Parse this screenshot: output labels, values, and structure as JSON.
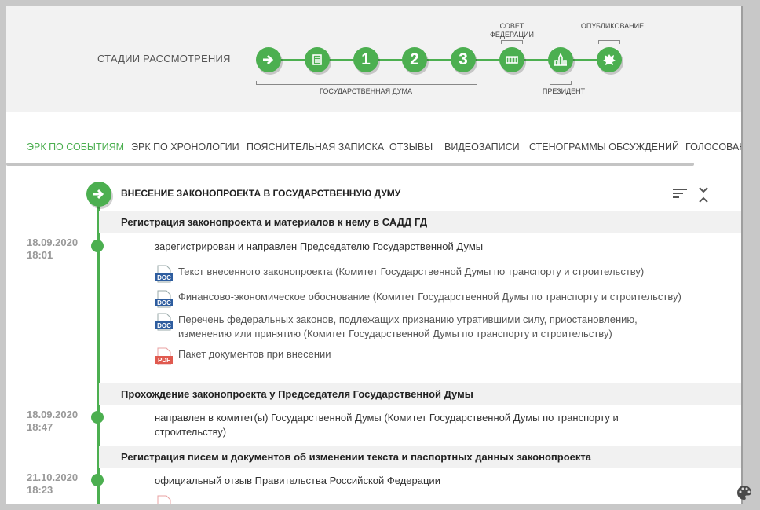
{
  "stages": {
    "title": "СТАДИИ РАССМОТРЕНИЯ",
    "steps": [
      {
        "icon": "arrow-right-icon",
        "label": ""
      },
      {
        "icon": "document-stack-icon",
        "label": ""
      },
      {
        "icon": "number-icon",
        "label": "1"
      },
      {
        "icon": "number-icon",
        "label": "2"
      },
      {
        "icon": "number-icon",
        "label": "3"
      },
      {
        "icon": "federation-council-icon",
        "label": ""
      },
      {
        "icon": "kremlin-icon",
        "label": ""
      },
      {
        "icon": "coat-of-arms-icon",
        "label": ""
      }
    ],
    "caption_duma": "ГОСУДАРСТВЕННАЯ ДУМА",
    "caption_council": "СОВЕТ ФЕДЕРАЦИИ",
    "caption_president": "ПРЕЗИДЕНТ",
    "caption_publication": "ОПУБЛИКОВАНИЕ"
  },
  "tabs": [
    {
      "label": "ЭРК ПО СОБЫТИЯМ",
      "active": true
    },
    {
      "label": "ЭРК ПО ХРОНОЛОГИИ"
    },
    {
      "label": "ПОЯСНИТЕЛЬНАЯ ЗАПИСКА"
    },
    {
      "label": "ОТЗЫВЫ"
    },
    {
      "label": "ВИДЕОЗАПИСИ"
    },
    {
      "label": "СТЕНОГРАММЫ ОБСУЖДЕНИЙ"
    },
    {
      "label": "ГОЛОСОВАН"
    }
  ],
  "section": {
    "title": "ВНЕСЕНИЕ ЗАКОНОПРОЕКТА В ГОСУДАРСТВЕННУЮ ДУМУ"
  },
  "groups": [
    {
      "title": "Регистрация законопроекта и материалов к нему в САДД ГД",
      "date": "18.09.2020",
      "time": "18:01",
      "event": "зарегистрирован и направлен Председателю Государственной Думы",
      "docs": [
        {
          "type": "DOC",
          "text": "Текст внесенного законопроекта (Комитет Государственной Думы по транспорту и строительству)"
        },
        {
          "type": "DOC",
          "text": "Финансово-экономическое обоснование (Комитет Государственной Думы по транспорту и строительству)"
        },
        {
          "type": "DOC",
          "text": "Перечень федеральных законов, подлежащих признанию утратившими силу, приостановлению,",
          "text2": "изменению или принятию (Комитет Государственной Думы по транспорту и строительству)"
        },
        {
          "type": "PDF",
          "text": "Пакет документов при внесении"
        }
      ]
    },
    {
      "title": "Прохождение законопроекта у Председателя Государственной Думы",
      "date": "18.09.2020",
      "time": "18:47",
      "event": "направлен в комитет(ы) Государственной Думы (Комитет Государственной Думы по транспорту и",
      "event2": "строительству)"
    },
    {
      "title": "Регистрация писем и документов об изменении текста и паспортных данных законопроекта",
      "date": "21.10.2020",
      "time": "18:23",
      "event": "официальный отзыв Правительства Российской Федерации"
    }
  ],
  "colors": {
    "accent": "#4caf50",
    "doc": "#2e5d9f",
    "pdf": "#e05a4f"
  }
}
